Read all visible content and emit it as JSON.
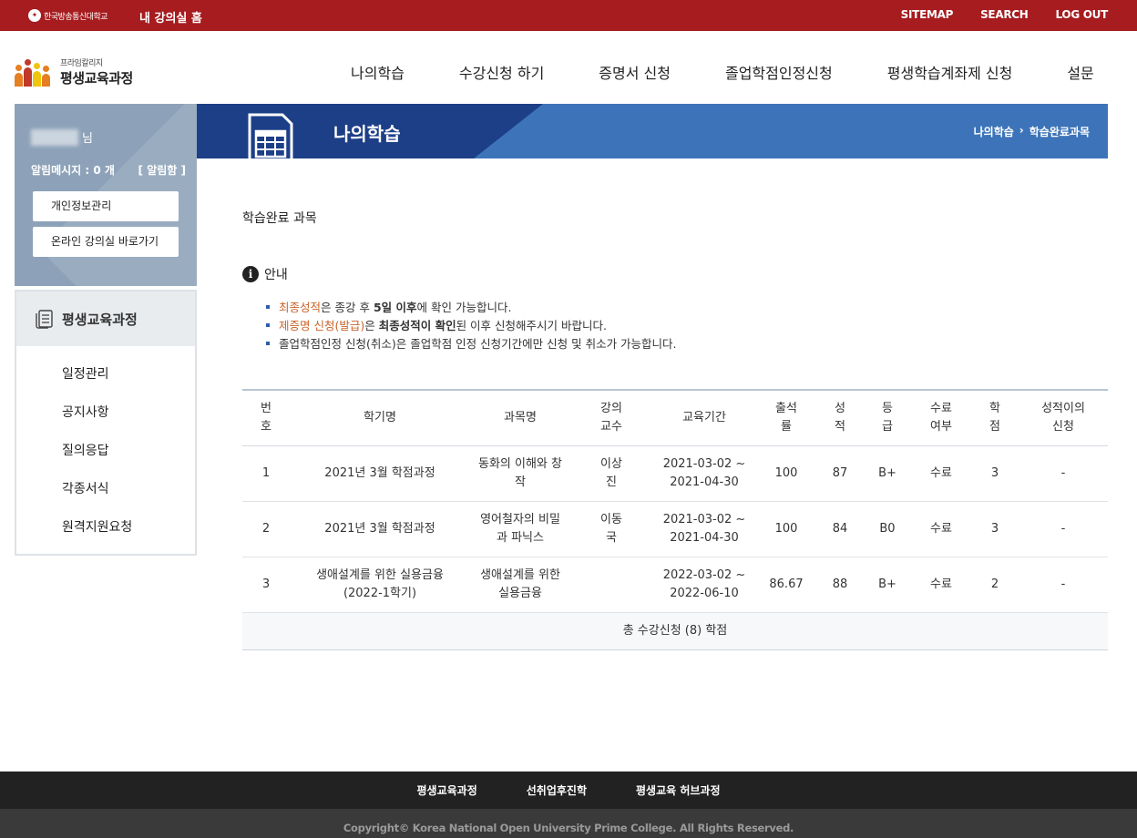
{
  "topbar": {
    "university": "한국방송통신대학교",
    "home": "내 강의실 홈",
    "links": [
      "SITEMAP",
      "SEARCH",
      "LOG OUT"
    ]
  },
  "logo": {
    "small": "프라임칼리지",
    "title": "평생교육과정"
  },
  "gnb": [
    "나의학습",
    "수강신청 하기",
    "증명서 신청",
    "졸업학점인정신청",
    "평생학습계좌제 신청",
    "설문"
  ],
  "sidebar": {
    "user_suffix": "님",
    "msg_label": "알림메시지 : 0 개",
    "msg_link": "[ 알림함 ]",
    "buttons": [
      "개인정보관리",
      "온라인 강의실 바로가기"
    ],
    "menu_title": "평생교육과정",
    "menu_items": [
      "일정관리",
      "공지사항",
      "질의응답",
      "각종서식",
      "원격지원요청"
    ]
  },
  "banner": {
    "title": "나의학습",
    "breadcrumb": [
      "나의학습",
      "학습완료과목"
    ]
  },
  "content": {
    "heading": "학습완료 과목",
    "notice_title": "안내",
    "notes": [
      {
        "hl": "최종성적",
        "rest1": "은 종강 후 ",
        "b1": "5일 이후",
        "rest2": "에 확인 가능합니다."
      },
      {
        "hl": "제증명 신청(발급)",
        "rest1": "은 ",
        "b1": "최종성적이 확인",
        "rest2": "된 이후 신청해주시기 바랍니다."
      },
      {
        "text": "졸업학점인정 신청(취소)은 졸업학점 인정 신청기간에만 신청 및 취소가 가능합니다."
      }
    ]
  },
  "table": {
    "headers": [
      [
        "번",
        "호"
      ],
      [
        "학기명"
      ],
      [
        "과목명"
      ],
      [
        "강의",
        "교수"
      ],
      [
        "교육기간"
      ],
      [
        "출석",
        "률"
      ],
      [
        "성",
        "적"
      ],
      [
        "등",
        "급"
      ],
      [
        "수료",
        "여부"
      ],
      [
        "학",
        "점"
      ],
      [
        "성적이의",
        "신청"
      ]
    ],
    "rows": [
      {
        "no": "1",
        "term": [
          "2021년 3월 학점과정"
        ],
        "course": [
          "동화의 이해와 창",
          "작"
        ],
        "prof": [
          "이상",
          "진"
        ],
        "period": [
          "2021-03-02 ~",
          "2021-04-30"
        ],
        "attendance": "100",
        "score": "87",
        "grade": "B+",
        "completion": "수료",
        "credit": "3",
        "appeal": "-"
      },
      {
        "no": "2",
        "term": [
          "2021년 3월 학점과정"
        ],
        "course": [
          "영어철자의 비밀",
          "과 파닉스"
        ],
        "prof": [
          "이동",
          "국"
        ],
        "period": [
          "2021-03-02 ~",
          "2021-04-30"
        ],
        "attendance": "100",
        "score": "84",
        "grade": "B0",
        "completion": "수료",
        "credit": "3",
        "appeal": "-"
      },
      {
        "no": "3",
        "term": [
          "생애설계를 위한 실용금융",
          "(2022-1학기)"
        ],
        "course": [
          "생애설계를 위한",
          "실용금융"
        ],
        "prof": [],
        "period": [
          "2022-03-02 ~",
          "2022-06-10"
        ],
        "attendance": "86.67",
        "score": "88",
        "grade": "B+",
        "completion": "수료",
        "credit": "2",
        "appeal": "-"
      }
    ],
    "total": "총 수강신청 (8) 학점"
  },
  "footer": {
    "links": [
      "평생교육과정",
      "선취업후진학",
      "평생교육 허브과정"
    ],
    "copyright": "Copyright© Korea National Open University Prime College. All Rights Reserved."
  },
  "colors": {
    "topbar": "#a61c1f",
    "banner_dark": "#1d3f87",
    "banner_light": "#3d74b9",
    "highlight": "#c8642a"
  }
}
